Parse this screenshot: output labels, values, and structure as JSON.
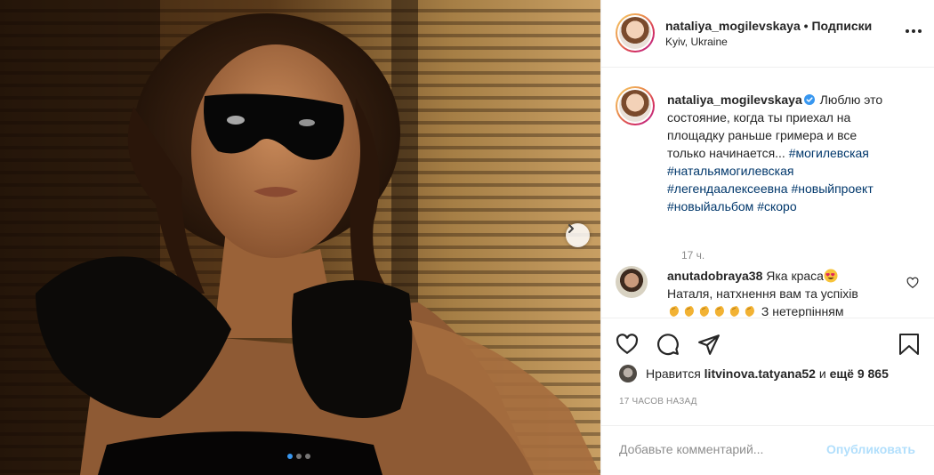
{
  "post": {
    "username": "nataliya_mogilevskaya",
    "separator": "•",
    "follow_label": "Подписки",
    "location": "Kyiv, Ukraine",
    "caption_lines": [
      "Люблю это",
      "состояние, когда ты приехал на",
      "площадку раньше гримера и все",
      "только начинается..."
    ],
    "hashtags": [
      "#могилевская",
      "#натальямогилевская",
      "#легендаалексеевна",
      "#новыйпроект",
      "#новыйальбом",
      "#скоро"
    ],
    "caption_time": "17 ч.",
    "comment": {
      "username": "anutadobraya38",
      "text_start": "Яка краса",
      "text_line2": "Наталя, натхнення вам та успіхів",
      "text_tail": "З нетерпінням"
    },
    "likes": {
      "prefix": "Нравится",
      "user": "litvinova.tatyana52",
      "middle": "и",
      "rest": "ещё 9 865"
    },
    "posted_time": "17 ЧАСОВ НАЗАД",
    "comment_placeholder": "Добавьте комментарий...",
    "publish_label": "Опубликовать",
    "carousel": {
      "total": 3,
      "active": 1
    }
  },
  "icons": {
    "more": "more-options-icon",
    "like": "heart-icon",
    "comment": "comment-icon",
    "share": "send-icon",
    "save": "bookmark-icon",
    "next": "chevron-right-icon",
    "verified": "verified-badge-icon"
  },
  "colors": {
    "hashtag": "#00376b",
    "verified": "#3897f0",
    "publish_disabled": "#b2dffc",
    "muted": "#8e8e8e"
  }
}
